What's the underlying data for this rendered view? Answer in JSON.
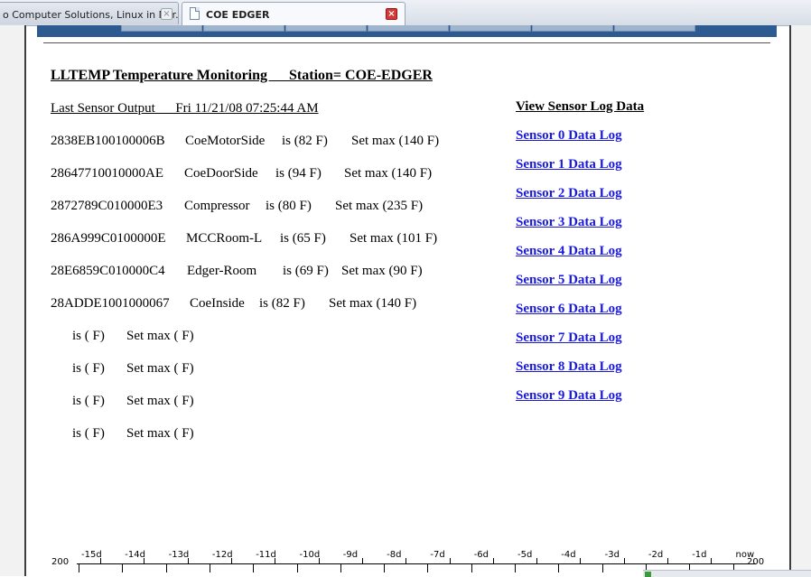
{
  "browser": {
    "tabs": [
      {
        "label": "o Computer Solutions, Linux in Nor...",
        "active": false
      },
      {
        "label": "COE EDGER",
        "active": true
      }
    ]
  },
  "page": {
    "title": "LLTEMP Temperature Monitoring      Station= COE-EDGER",
    "last_output": "Last Sensor Output      Fri 11/21/08 07:25:44 AM",
    "sensors": [
      {
        "id": "2838EB100100006B",
        "name": "CoeMotorSide",
        "reading": "is (82 F)",
        "setmax": "Set max (140 F)"
      },
      {
        "id": "28647710010000AE",
        "name": "CoeDoorSide",
        "reading": "is (94 F)",
        "setmax": "Set max (140 F)"
      },
      {
        "id": "2872789C010000E3",
        "name": "Compressor",
        "reading": "is (80 F)",
        "setmax": "Set max (235 F)"
      },
      {
        "id": "286A999C0100000E",
        "name": "MCCRoom-L",
        "reading": "is (65 F)",
        "setmax": "Set max (101 F)"
      },
      {
        "id": "28E6859C010000C4",
        "name": "Edger-Room",
        "reading": "is (69 F)",
        "setmax": "Set max (90 F)"
      },
      {
        "id": "28ADDE1001000067",
        "name": "CoeInside",
        "reading": "is (82 F)",
        "setmax": "Set max (140 F)"
      },
      {
        "id": "",
        "name": "",
        "reading": "is ( F)",
        "setmax": "Set max ( F)"
      },
      {
        "id": "",
        "name": "",
        "reading": "is ( F)",
        "setmax": "Set max ( F)"
      },
      {
        "id": "",
        "name": "",
        "reading": "is ( F)",
        "setmax": "Set max ( F)"
      },
      {
        "id": "",
        "name": "",
        "reading": "is ( F)",
        "setmax": "Set max ( F)"
      }
    ],
    "log_header": "View Sensor Log Data",
    "log_links": [
      "Sensor 0 Data Log",
      "Sensor 1 Data Log",
      "Sensor 2 Data Log",
      "Sensor 3 Data Log",
      "Sensor 4 Data Log",
      "Sensor 5 Data Log",
      "Sensor 6 Data Log",
      "Sensor 7 Data Log",
      "Sensor 8 Data Log",
      "Sensor 9 Data Log"
    ],
    "ruler": {
      "left_value": "200",
      "right_value": "200",
      "labels": [
        "-15d",
        "-14d",
        "-13d",
        "-12d",
        "-11d",
        "-10d",
        "-9d",
        "-8d",
        "-7d",
        "-6d",
        "-5d",
        "-4d",
        "-3d",
        "-2d",
        "-1d",
        "now"
      ]
    }
  },
  "colors": {
    "nav_bar": "#2c5a91",
    "link": "#1a1adf",
    "close_active": "#d23a3a"
  }
}
